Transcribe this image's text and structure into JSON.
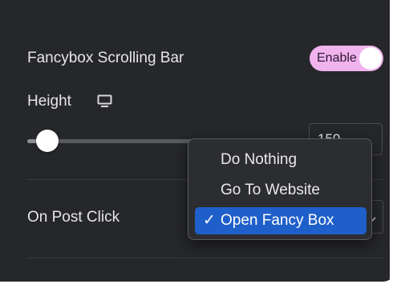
{
  "scrolling_bar": {
    "label": "Fancybox Scrolling Bar",
    "toggle_label": "Enable",
    "enabled": true
  },
  "height": {
    "label": "Height",
    "device_icon": "desktop-monitor-icon",
    "value": "150"
  },
  "post_click": {
    "label": "On Post Click",
    "options": [
      "Do Nothing",
      "Go To Website",
      "Open Fancy Box"
    ],
    "selected": "Open Fancy Box",
    "check_glyph": "✓"
  },
  "colors": {
    "panel_bg": "#26272b",
    "toggle_bg": "#f1b3ee",
    "selected_bg": "#1f5fc9"
  }
}
